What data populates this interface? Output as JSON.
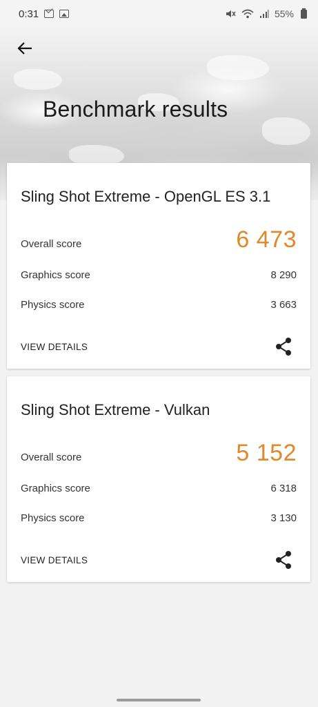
{
  "status_bar": {
    "time": "0:31",
    "battery": "55%",
    "icons": [
      "gmail-icon",
      "gallery-icon",
      "mute-icon",
      "wifi-icon",
      "signal-icon",
      "battery-icon"
    ]
  },
  "header": {
    "title": "Benchmark results",
    "back_icon": "arrow-left-icon"
  },
  "results": [
    {
      "title": "Sling Shot Extreme - OpenGL ES 3.1",
      "overall_label": "Overall score",
      "overall_value": "6 473",
      "graphics_label": "Graphics score",
      "graphics_value": "8 290",
      "physics_label": "Physics score",
      "physics_value": "3 663",
      "details_label": "VIEW DETAILS",
      "share_icon": "share-icon"
    },
    {
      "title": "Sling Shot Extreme - Vulkan",
      "overall_label": "Overall score",
      "overall_value": "5 152",
      "graphics_label": "Graphics score",
      "graphics_value": "6 318",
      "physics_label": "Physics score",
      "physics_value": "3 130",
      "details_label": "VIEW DETAILS",
      "share_icon": "share-icon"
    }
  ],
  "colors": {
    "accent": "#e0882b",
    "background": "#f2f2f2",
    "card": "#ffffff"
  }
}
